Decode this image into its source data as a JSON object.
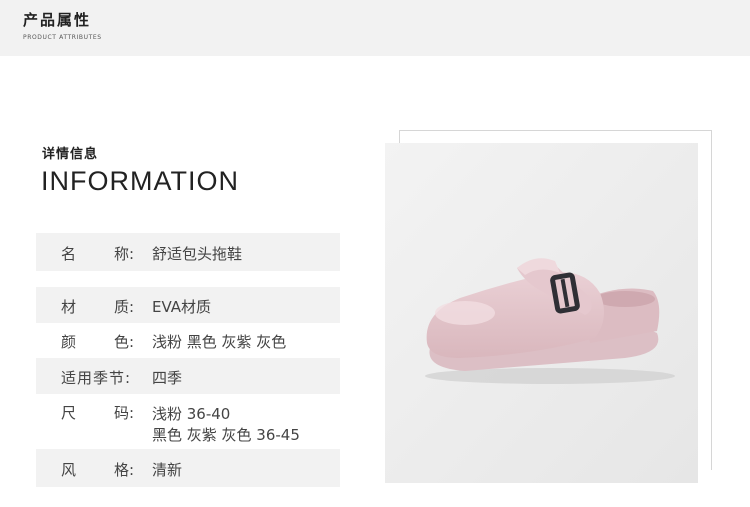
{
  "header": {
    "title": "产品属性",
    "subtitle": "PRODUCT ATTRIBUTES"
  },
  "info": {
    "title_cn": "详情信息",
    "title_en": "INFORMATION"
  },
  "attributes": [
    {
      "key1": "名",
      "key2": "称:",
      "value": "舒适包头拖鞋"
    },
    {
      "key1": "材",
      "key2": "质:",
      "value": "EVA材质"
    },
    {
      "key1": "颜",
      "key2": "色:",
      "value": "浅粉  黑色  灰紫  灰色"
    },
    {
      "key_full": "适用季节:",
      "value": "四季"
    },
    {
      "key1": "尺",
      "key2": "码:",
      "value": "浅粉  36-40",
      "value2": "黑色 灰紫 灰色 36-45"
    },
    {
      "key1": "风",
      "key2": "格:",
      "value": "清新"
    }
  ],
  "product_image": {
    "icon": "clog-slipper-image",
    "color": "#e3c5cb"
  }
}
